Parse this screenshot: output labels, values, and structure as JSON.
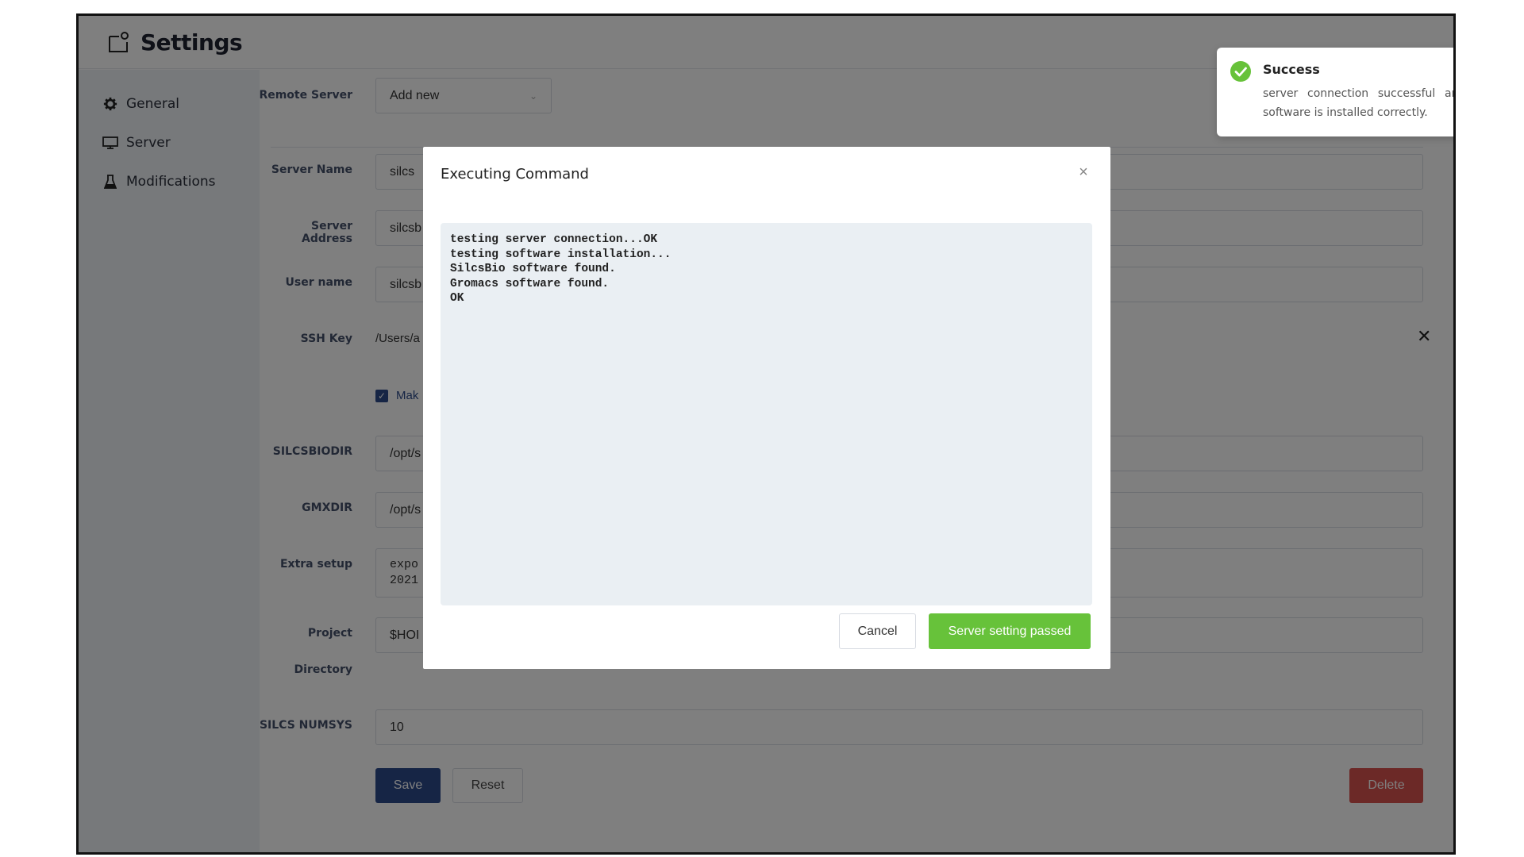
{
  "header": {
    "title": "Settings",
    "logo_icon": "settings-page-icon"
  },
  "sidebar": {
    "items": [
      {
        "label": "General",
        "icon": "gear-icon"
      },
      {
        "label": "Server",
        "icon": "monitor-icon"
      },
      {
        "label": "Modifications",
        "icon": "flask-icon"
      }
    ]
  },
  "form": {
    "remote_server": {
      "label": "Remote Server",
      "value": "Add new"
    },
    "server_name": {
      "label": "Server Name",
      "value": "silcs"
    },
    "server_address": {
      "label": "Server Address",
      "value": "silcsb"
    },
    "user_name": {
      "label": "User name",
      "value": "silcsb"
    },
    "ssh_key": {
      "label": "SSH Key",
      "value": "/Users/a"
    },
    "make_checkbox": {
      "label": "Mak",
      "checked": true
    },
    "silcsbiodir": {
      "label": "SILCSBIODIR",
      "value": "/opt/s"
    },
    "gmxdir": {
      "label": "GMXDIR",
      "value": "/opt/s"
    },
    "extra_setup": {
      "label": "Extra setup",
      "value_line1": "expo",
      "value_line2": "2021"
    },
    "project_dir": {
      "label_line1": "Project",
      "label_line2": "Directory",
      "value": "$HOI"
    },
    "silcs_numsys": {
      "label": "SILCS NUMSYS",
      "value": "10"
    },
    "buttons": {
      "save": "Save",
      "reset": "Reset",
      "delete": "Delete"
    }
  },
  "modal": {
    "title": "Executing Command",
    "console": "testing server connection...OK\ntesting software installation...\nSilcsBio software found.\nGromacs software found.\nOK",
    "cancel": "Cancel",
    "confirm": "Server setting passed"
  },
  "toast": {
    "title": "Success",
    "message": "server connection successful and the software is installed correctly.",
    "icon": "check-circle-icon"
  },
  "colors": {
    "primary": "#2d4a8a",
    "success": "#67c23a",
    "danger": "#d9534f"
  }
}
